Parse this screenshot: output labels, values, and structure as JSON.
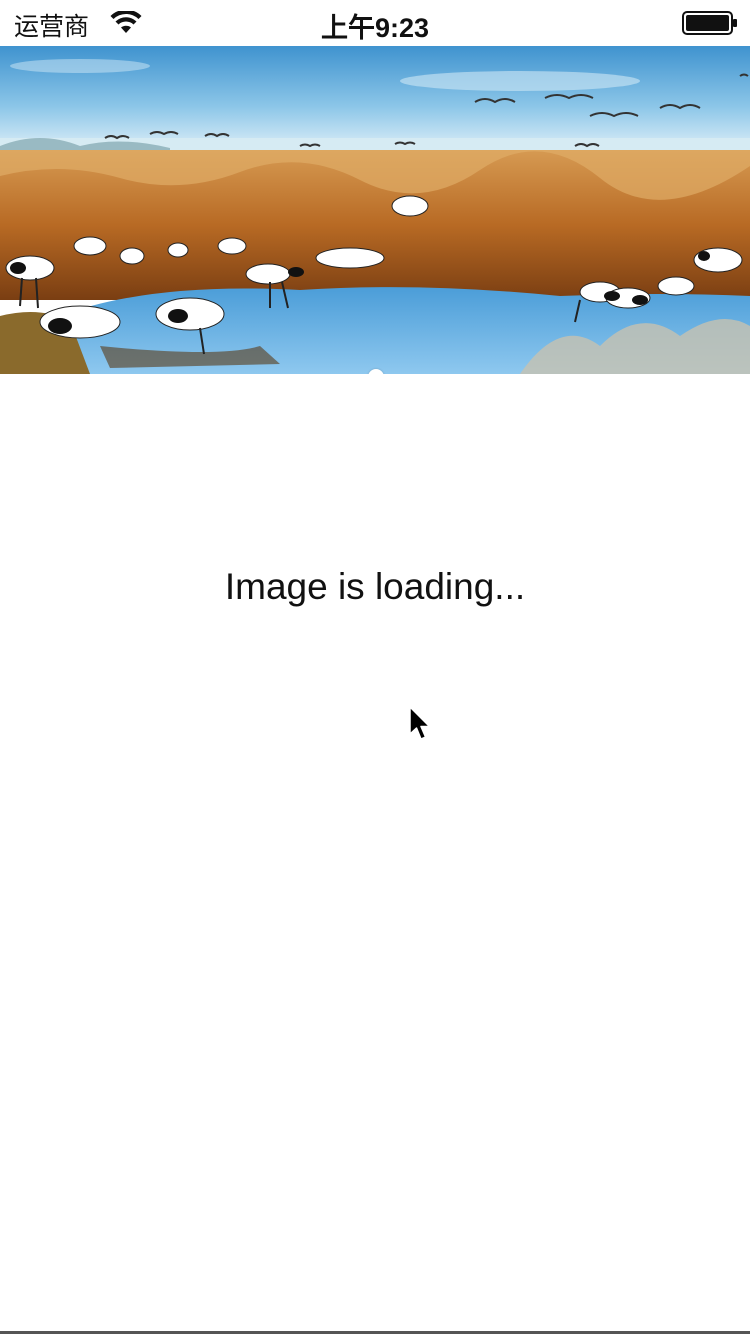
{
  "status_bar": {
    "carrier": "运营商",
    "time": "上午9:23",
    "wifi_icon": "wifi-icon",
    "battery_icon": "battery-icon"
  },
  "banner": {
    "image": "cranes-wetland-photo",
    "pager": {
      "total": 1,
      "current": 1
    }
  },
  "content": {
    "loading_text": "Image is loading..."
  },
  "cursor_icon": "mouse-pointer-icon"
}
